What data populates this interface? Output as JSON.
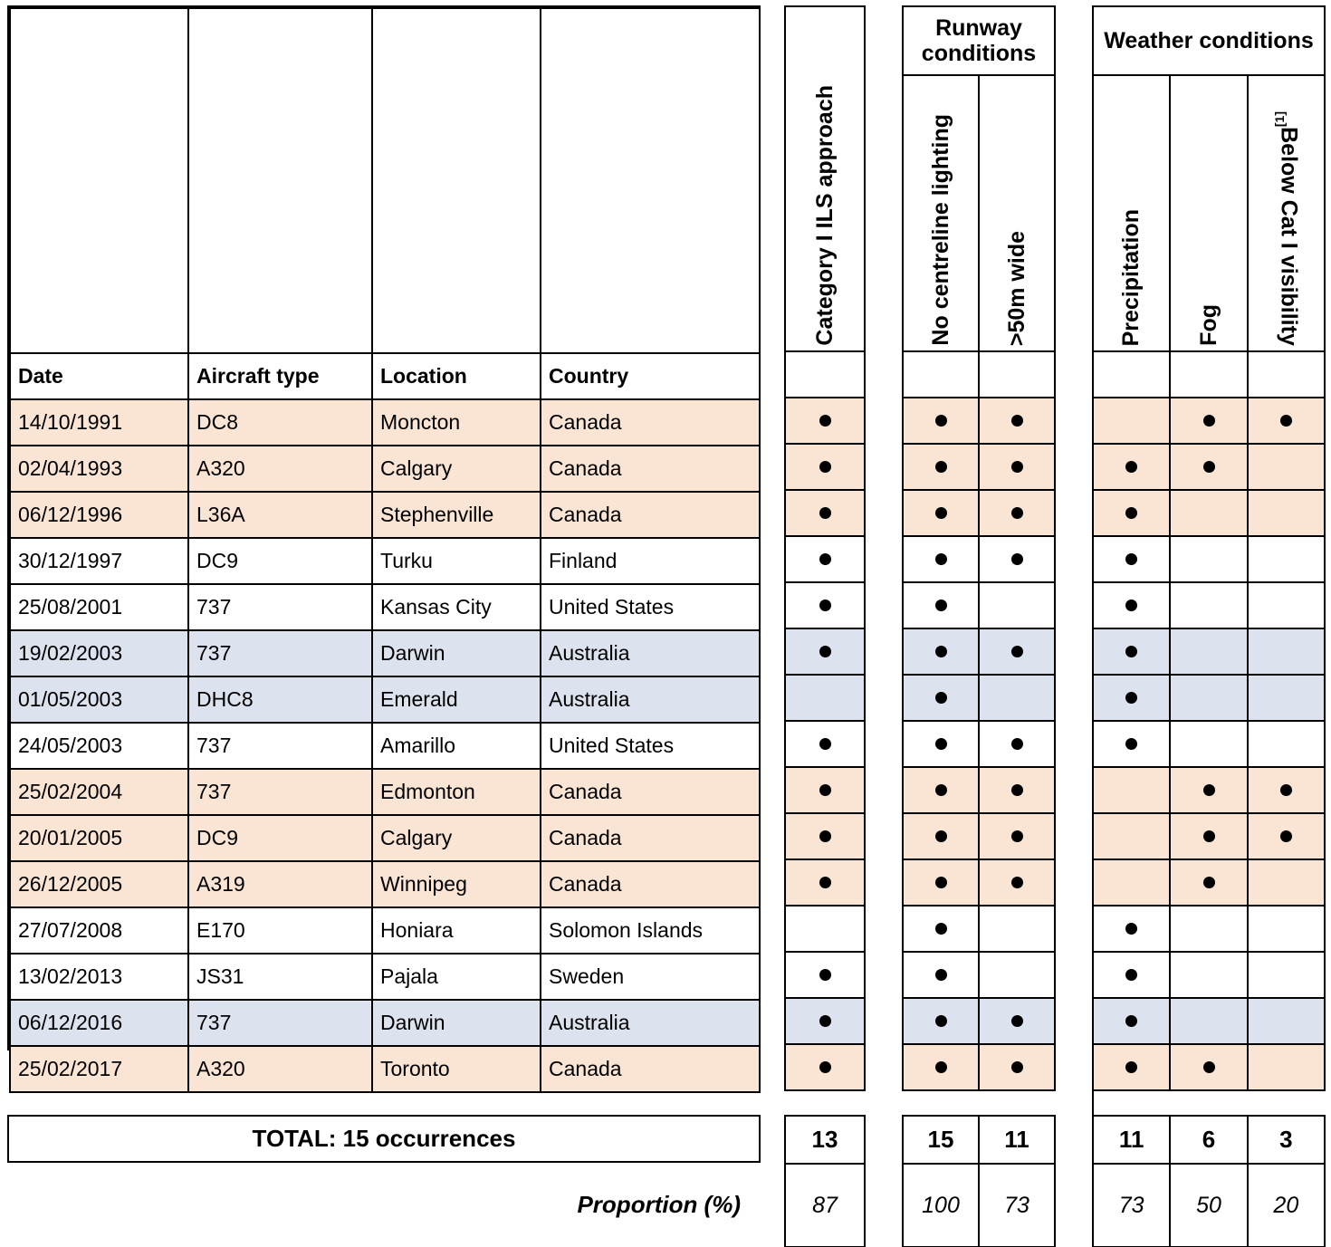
{
  "table": {
    "columns": [
      "Date",
      "Aircraft type",
      "Location",
      "Country"
    ],
    "rows": [
      {
        "date": "14/10/1991",
        "aircraft": "DC8",
        "location": "Moncton",
        "country": "Canada",
        "shade": "peach",
        "ils": true,
        "no_centreline": true,
        "wide50": true,
        "precip": false,
        "fog": true,
        "below_cat1": true
      },
      {
        "date": "02/04/1993",
        "aircraft": "A320",
        "location": "Calgary",
        "country": "Canada",
        "shade": "peach",
        "ils": true,
        "no_centreline": true,
        "wide50": true,
        "precip": true,
        "fog": true,
        "below_cat1": false
      },
      {
        "date": "06/12/1996",
        "aircraft": "L36A",
        "location": "Stephenville",
        "country": "Canada",
        "shade": "peach",
        "ils": true,
        "no_centreline": true,
        "wide50": true,
        "precip": true,
        "fog": false,
        "below_cat1": false
      },
      {
        "date": "30/12/1997",
        "aircraft": "DC9",
        "location": "Turku",
        "country": "Finland",
        "shade": "white",
        "ils": true,
        "no_centreline": true,
        "wide50": true,
        "precip": true,
        "fog": false,
        "below_cat1": false
      },
      {
        "date": "25/08/2001",
        "aircraft": "737",
        "location": "Kansas City",
        "country": "United States",
        "shade": "white",
        "ils": true,
        "no_centreline": true,
        "wide50": false,
        "precip": true,
        "fog": false,
        "below_cat1": false
      },
      {
        "date": "19/02/2003",
        "aircraft": "737",
        "location": "Darwin",
        "country": "Australia",
        "shade": "blue",
        "ils": true,
        "no_centreline": true,
        "wide50": true,
        "precip": true,
        "fog": false,
        "below_cat1": false
      },
      {
        "date": "01/05/2003",
        "aircraft": "DHC8",
        "location": "Emerald",
        "country": "Australia",
        "shade": "blue",
        "ils": false,
        "no_centreline": true,
        "wide50": false,
        "precip": true,
        "fog": false,
        "below_cat1": false
      },
      {
        "date": "24/05/2003",
        "aircraft": "737",
        "location": "Amarillo",
        "country": "United States",
        "shade": "white",
        "ils": true,
        "no_centreline": true,
        "wide50": true,
        "precip": true,
        "fog": false,
        "below_cat1": false
      },
      {
        "date": "25/02/2004",
        "aircraft": "737",
        "location": "Edmonton",
        "country": "Canada",
        "shade": "peach",
        "ils": true,
        "no_centreline": true,
        "wide50": true,
        "precip": false,
        "fog": true,
        "below_cat1": true
      },
      {
        "date": "20/01/2005",
        "aircraft": "DC9",
        "location": "Calgary",
        "country": "Canada",
        "shade": "peach",
        "ils": true,
        "no_centreline": true,
        "wide50": true,
        "precip": false,
        "fog": true,
        "below_cat1": true
      },
      {
        "date": "26/12/2005",
        "aircraft": "A319",
        "location": "Winnipeg",
        "country": "Canada",
        "shade": "peach",
        "ils": true,
        "no_centreline": true,
        "wide50": true,
        "precip": false,
        "fog": true,
        "below_cat1": false
      },
      {
        "date": "27/07/2008",
        "aircraft": "E170",
        "location": "Honiara",
        "country": "Solomon Islands",
        "shade": "white",
        "ils": false,
        "no_centreline": true,
        "wide50": false,
        "precip": true,
        "fog": false,
        "below_cat1": false
      },
      {
        "date": "13/02/2013",
        "aircraft": "JS31",
        "location": "Pajala",
        "country": "Sweden",
        "shade": "white",
        "ils": true,
        "no_centreline": true,
        "wide50": false,
        "precip": true,
        "fog": false,
        "below_cat1": false
      },
      {
        "date": "06/12/2016",
        "aircraft": "737",
        "location": "Darwin",
        "country": "Australia",
        "shade": "blue",
        "ils": true,
        "no_centreline": true,
        "wide50": true,
        "precip": true,
        "fog": false,
        "below_cat1": false
      },
      {
        "date": "25/02/2017",
        "aircraft": "A320",
        "location": "Toronto",
        "country": "Canada",
        "shade": "peach",
        "ils": true,
        "no_centreline": true,
        "wide50": true,
        "precip": true,
        "fog": true,
        "below_cat1": false
      }
    ]
  },
  "condition_groups": {
    "ils": {
      "title": "",
      "header": "Category I ILS approach"
    },
    "runway": {
      "title": "Runway conditions",
      "headers": [
        "No centreline lighting",
        ">50m wide"
      ]
    },
    "weather": {
      "title": "Weather conditions",
      "headers": [
        "Precipitation",
        "Fog",
        "Below Cat I visibility"
      ],
      "footnote": "[1]"
    }
  },
  "totals": {
    "label": "TOTAL: 15 occurrences",
    "proportion_label": "Proportion (%)",
    "counts": {
      "ils": "13",
      "no_centreline": "15",
      "wide50": "11",
      "precip": "11",
      "fog": "6",
      "below_cat1": "3"
    },
    "proportions": {
      "ils": "87",
      "no_centreline": "100",
      "wide50": "73",
      "precip": "73",
      "fog": "50",
      "below_cat1": "20"
    }
  },
  "colors": {
    "peach": "#fae4d3",
    "blue": "#dce2ee",
    "border": "#000000",
    "dot": "#000000"
  }
}
